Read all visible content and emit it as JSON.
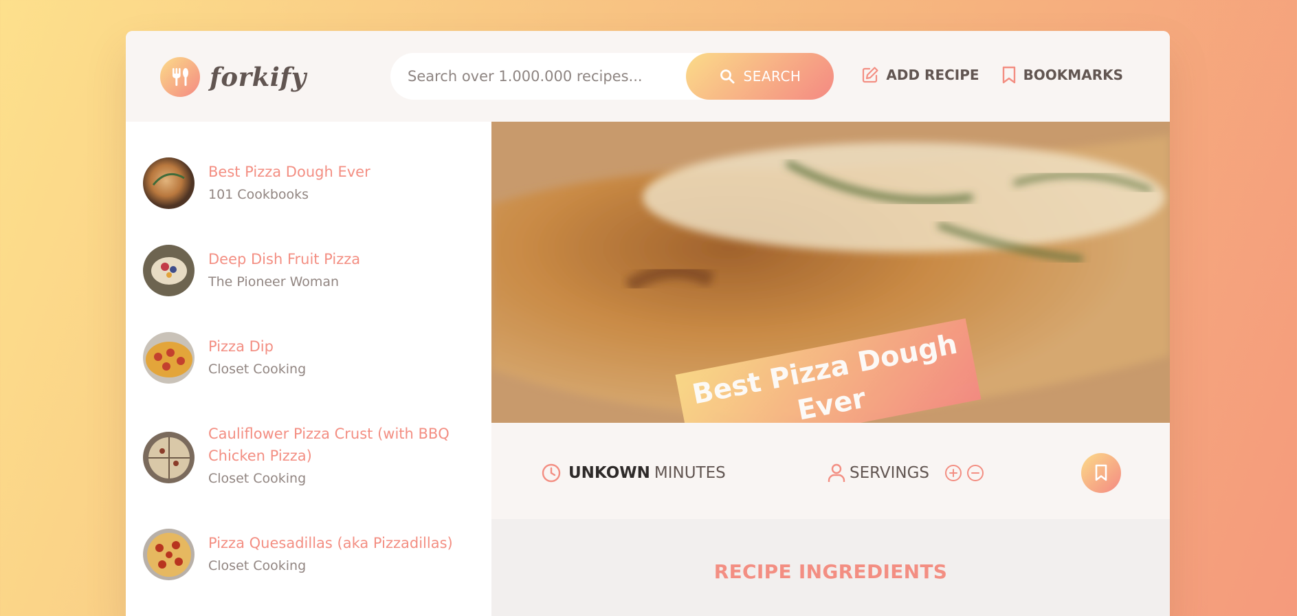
{
  "app": {
    "logo_text": "forkify"
  },
  "search": {
    "placeholder": "Search over 1.000.000 recipes...",
    "button_label": "SEARCH"
  },
  "nav": {
    "add_recipe": "ADD RECIPE",
    "bookmarks": "BOOKMARKS"
  },
  "results": [
    {
      "title": "Best Pizza Dough Ever",
      "publisher": "101 Cookbooks"
    },
    {
      "title": "Deep Dish Fruit Pizza",
      "publisher": "The Pioneer Woman"
    },
    {
      "title": "Pizza Dip",
      "publisher": "Closet Cooking"
    },
    {
      "title": "Cauliflower Pizza Crust (with BBQ Chicken Pizza)",
      "publisher": "Closet Cooking"
    },
    {
      "title": "Pizza Quesadillas (aka Pizzadillas)",
      "publisher": "Closet Cooking"
    }
  ],
  "recipe": {
    "title": "Best Pizza Dough Ever",
    "time_value": "UNKOWN",
    "time_unit": "MINUTES",
    "servings_label": "SERVINGS",
    "ingredients_heading": "RECIPE INGREDIENTS"
  },
  "icons": {
    "logo": "fork-knife-icon",
    "search": "search-icon",
    "add_recipe": "edit-icon",
    "bookmarks": "bookmark-icon",
    "time": "clock-icon",
    "servings": "user-icon",
    "increase": "plus-circle-icon",
    "decrease": "minus-circle-icon",
    "bookmark_button": "bookmark-icon"
  },
  "colors": {
    "accent": "#f38e82",
    "gradient_start": "#fbdb89",
    "gradient_end": "#f48982",
    "text": "#615551",
    "header_bg": "#f9f5f3"
  }
}
